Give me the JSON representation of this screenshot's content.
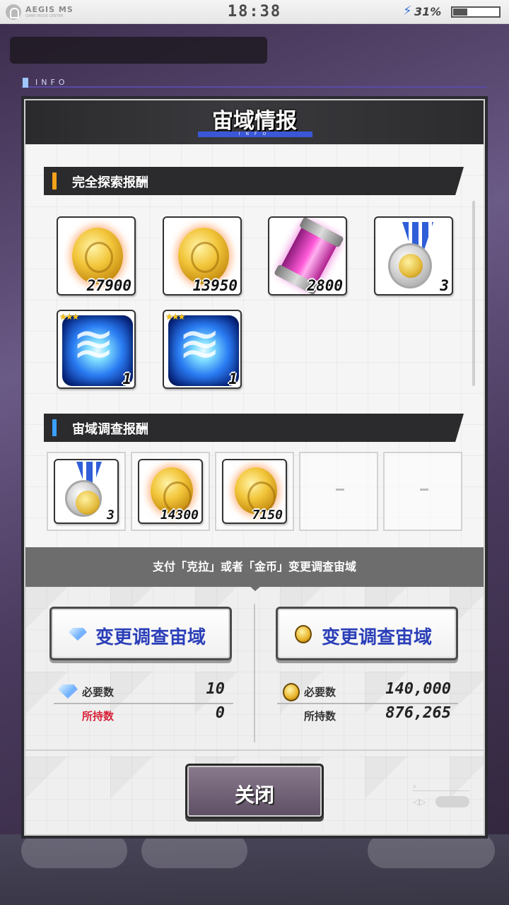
{
  "status_bar": {
    "brand": "AEGIS MS",
    "brand_sub": "GAME MODE CENTER",
    "time": "18:38",
    "battery_percent_label": "31%",
    "battery_level": 0.31
  },
  "background": {
    "info_label": "INFO"
  },
  "modal": {
    "title": "宙域情报",
    "title_sub": "INFO",
    "section_full_explore": "完全探索报酬",
    "section_survey": "宙域调查报酬",
    "full_explore_rewards": [
      {
        "icon": "gold-coin-icon",
        "qty": "27900"
      },
      {
        "icon": "gold-coin-icon",
        "qty": "13950"
      },
      {
        "icon": "pink-capsule-icon",
        "qty": "2800"
      },
      {
        "icon": "medal-icon",
        "qty": "3"
      },
      {
        "icon": "blue-crystal-icon",
        "qty": "1",
        "stars": "★★★"
      },
      {
        "icon": "blue-crystal-icon",
        "qty": "1",
        "stars": "★★★"
      }
    ],
    "survey_rewards": [
      {
        "icon": "medal-icon",
        "qty": "3"
      },
      {
        "icon": "gold-coin-icon",
        "qty": "14300"
      },
      {
        "icon": "gold-coin-icon",
        "qty": "7150"
      },
      {
        "empty": "-"
      },
      {
        "empty": "-"
      }
    ],
    "notice": "支付「克拉」或者「金币」变更调查宙域",
    "change_with_gems": {
      "button_label": "变更调查宙域",
      "required_label": "必要数",
      "required_value": "10",
      "owned_label": "所持数",
      "owned_value": "0"
    },
    "change_with_coins": {
      "button_label": "变更调查宙域",
      "required_label": "必要数",
      "required_value": "140,000",
      "owned_label": "所持数",
      "owned_value": "876,265"
    },
    "close_label": "关闭"
  },
  "colors": {
    "accent_blue": "#3a57d8",
    "section_mark_gold": "#f5a21a",
    "section_mark_blue": "#3aa0ff",
    "warning_red": "#d8223a"
  }
}
